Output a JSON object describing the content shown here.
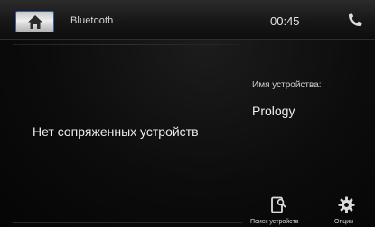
{
  "header": {
    "title": "Bluetooth",
    "clock": "00:45",
    "home_icon": "home-icon",
    "phone_icon": "phone-icon"
  },
  "main": {
    "no_devices_text": "Нет сопряженных устройств",
    "device_name_label": "Имя устройства:",
    "device_name_value": "Prology"
  },
  "footer": {
    "search_label": "Поиск устройств",
    "search_icon": "device-search-icon",
    "options_label": "Опции",
    "options_icon": "gear-icon"
  },
  "colors": {
    "accent_border": "#3b5aa0",
    "background": "#0a0a0a",
    "text": "#e8e8e8"
  }
}
